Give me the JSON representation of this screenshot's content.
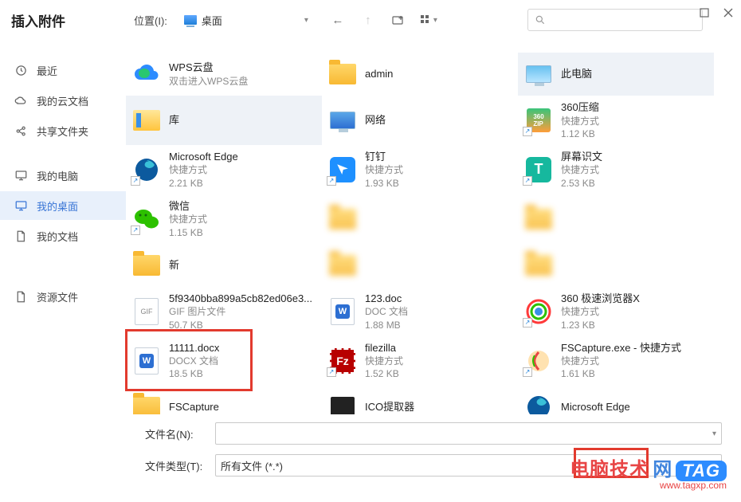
{
  "window": {
    "title": "插入附件"
  },
  "location": {
    "label": "位置(I):",
    "value": "桌面"
  },
  "search": {
    "placeholder": ""
  },
  "sidebar": {
    "items": [
      {
        "label": "最近",
        "icon": "clock"
      },
      {
        "label": "我的云文档",
        "icon": "cloud"
      },
      {
        "label": "共享文件夹",
        "icon": "share"
      },
      {
        "label": "我的电脑",
        "icon": "desktop"
      },
      {
        "label": "我的桌面",
        "icon": "desktop"
      },
      {
        "label": "我的文档",
        "icon": "doc"
      },
      {
        "label": "",
        "icon": "blur"
      },
      {
        "label": "资源文件",
        "icon": "doc"
      }
    ]
  },
  "grid": {
    "rows": [
      [
        {
          "name": "WPS云盘",
          "meta": "双击进入WPS云盘",
          "icon": "wpscloud"
        },
        {
          "name": "admin",
          "meta": "",
          "icon": "folder"
        },
        {
          "name": "此电脑",
          "meta": "",
          "icon": "thispc",
          "sel": true
        }
      ],
      [
        {
          "name": "库",
          "meta": "",
          "icon": "library",
          "sel": true
        },
        {
          "name": "网络",
          "meta": "",
          "icon": "network"
        },
        {
          "name": "360压缩",
          "meta": "快捷方式",
          "size": "1.12 KB",
          "icon": "zip360",
          "shortcut": true
        }
      ],
      [
        {
          "name": "Microsoft Edge",
          "meta": "快捷方式",
          "size": "2.21 KB",
          "icon": "edge",
          "shortcut": true
        },
        {
          "name": "钉钉",
          "meta": "快捷方式",
          "size": "1.93 KB",
          "icon": "dingding",
          "shortcut": true
        },
        {
          "name": "屏幕识文",
          "meta": "快捷方式",
          "size": "2.53 KB",
          "icon": "screentext",
          "shortcut": true
        }
      ],
      [
        {
          "name": "微信",
          "meta": "快捷方式",
          "size": "1.15 KB",
          "icon": "wechat",
          "shortcut": true
        },
        {
          "name": "",
          "meta": "",
          "icon": "blur"
        },
        {
          "name": "",
          "meta": "",
          "icon": "blur"
        }
      ],
      [
        {
          "name": "新",
          "meta": "",
          "icon": "folder"
        },
        {
          "name": "",
          "meta": "",
          "icon": "blur"
        },
        {
          "name": "",
          "meta": "",
          "icon": "blur"
        }
      ],
      [
        {
          "name": "5f9340bba899a5cb82ed06e3...",
          "meta": "GIF 图片文件",
          "size": "50.7 KB",
          "icon": "gif"
        },
        {
          "name": "123.doc",
          "meta": "DOC 文档",
          "size": "1.88 MB",
          "icon": "docw"
        },
        {
          "name": "360 极速浏览器X",
          "meta": "快捷方式",
          "size": "1.23 KB",
          "icon": "browser360",
          "shortcut": true
        }
      ],
      [
        {
          "name": "11111.docx",
          "meta": "DOCX 文档",
          "size": "18.5 KB",
          "icon": "docw"
        },
        {
          "name": "filezilla",
          "meta": "快捷方式",
          "size": "1.52 KB",
          "icon": "filezilla",
          "shortcut": true
        },
        {
          "name": "FSCapture.exe - 快捷方式",
          "meta": "快捷方式",
          "size": "1.61 KB",
          "icon": "fscapture",
          "shortcut": true
        }
      ],
      [
        {
          "name": "FSCapture",
          "meta": "",
          "icon": "folder"
        },
        {
          "name": "ICO提取器",
          "meta": "",
          "icon": "ico"
        },
        {
          "name": "Microsoft Edge",
          "meta": "",
          "icon": "edge"
        }
      ]
    ]
  },
  "footer": {
    "filename_label": "文件名(N):",
    "filename_value": "",
    "filetype_label": "文件类型(T):",
    "filetype_value": "所有文件 (*.*)"
  },
  "watermark": {
    "brand": "电脑技术",
    "net": "网",
    "tag": "TAG",
    "url": "www.tagxp.com"
  }
}
